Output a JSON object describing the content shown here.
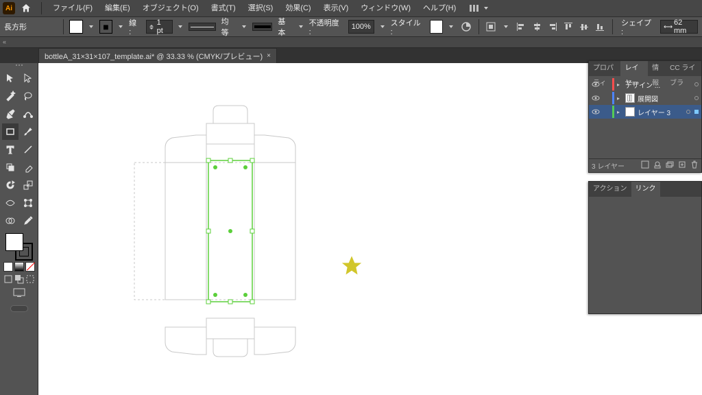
{
  "menubar": {
    "items": [
      "ファイル(F)",
      "編集(E)",
      "オブジェクト(O)",
      "書式(T)",
      "選択(S)",
      "効果(C)",
      "表示(V)",
      "ウィンドウ(W)",
      "ヘルプ(H)"
    ]
  },
  "ctrlbar": {
    "tool_name": "長方形",
    "stroke_label": "線 :",
    "stroke_weight": "1 pt",
    "dash_label": "均等",
    "brush_label": "基本",
    "opacity_label": "不透明度 :",
    "opacity_value": "100%",
    "style_label": "スタイル :",
    "shapes_label": "シェイプ :",
    "width_value": "62 mm"
  },
  "document_tab": {
    "title": "bottleA_31×31×107_template.ai* @ 33.33 % (CMYK/プレビュー)"
  },
  "layers_panel": {
    "tabs": [
      "プロパティ",
      "レイヤー",
      "情報",
      "CC ライブラ"
    ],
    "active_tab": 1,
    "layers": [
      {
        "name": "デザイン ...",
        "color": "#ff4d4d",
        "visible": true,
        "thumb": "star"
      },
      {
        "name": "展開図",
        "color": "#4d84ff",
        "visible": true,
        "thumb": "box"
      },
      {
        "name": "レイヤー 3",
        "color": "#55cc55",
        "visible": true,
        "thumb": "blank",
        "selected": true
      }
    ],
    "footer_count": "3 レイヤー"
  },
  "link_panel": {
    "tabs": [
      "アクション",
      "リンク"
    ],
    "active_tab": 1
  }
}
